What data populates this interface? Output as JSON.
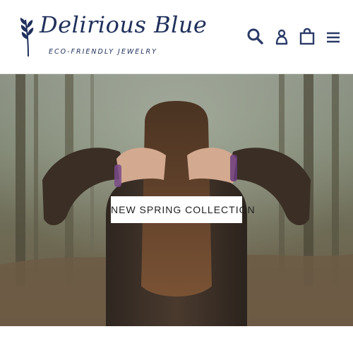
{
  "brand": {
    "name": "Delirious Blue",
    "tagline": "ECO-FRIENDLY JEWELRY"
  },
  "header_icons": [
    {
      "name": "search-icon",
      "label": "Search"
    },
    {
      "name": "account-icon",
      "label": "Log in"
    },
    {
      "name": "cart-icon",
      "label": "Cart"
    },
    {
      "name": "menu-icon",
      "label": "Menu"
    }
  ],
  "hero": {
    "cta_label": "NEW SPRING COLLECTION"
  },
  "colors": {
    "brand_navy": "#20305c",
    "icon_color": "#2a3a68",
    "cta_bg": "#ffffff"
  }
}
